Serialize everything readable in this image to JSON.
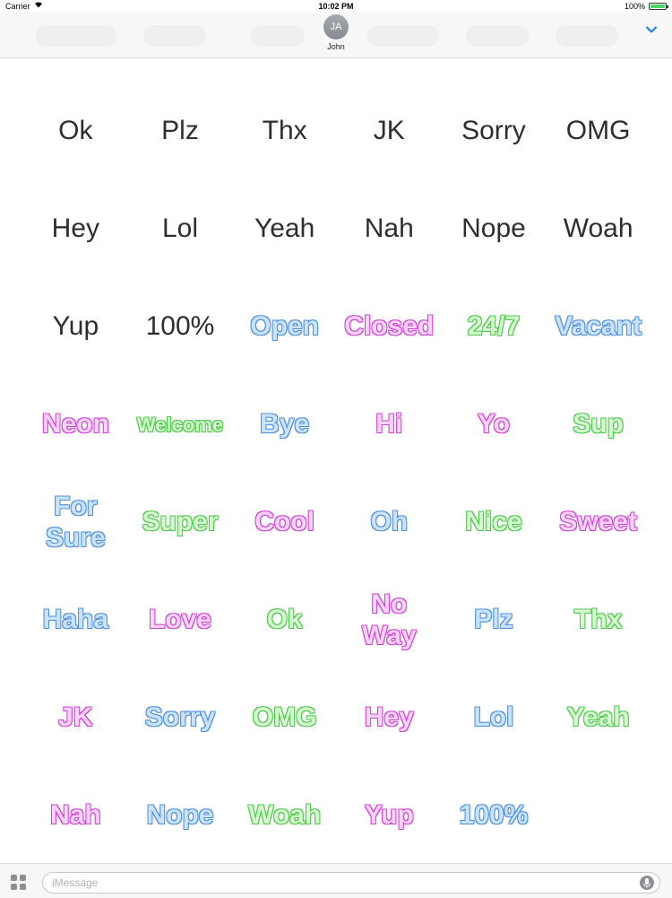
{
  "status_bar": {
    "carrier": "Carrier",
    "wifi_icon": "wifi-icon",
    "time": "10:02 PM",
    "battery_percent": "100%",
    "battery_level": 1.0
  },
  "header": {
    "avatar_initials": "JA",
    "contact_name": "John",
    "chevron_icon": "chevron-down-icon",
    "accent_color": "#1a7cff"
  },
  "stickers": [
    {
      "text": "Ok",
      "style": "dark"
    },
    {
      "text": "Plz",
      "style": "dark"
    },
    {
      "text": "Thx",
      "style": "dark"
    },
    {
      "text": "JK",
      "style": "dark"
    },
    {
      "text": "Sorry",
      "style": "dark"
    },
    {
      "text": "OMG",
      "style": "dark"
    },
    {
      "text": "Hey",
      "style": "dark"
    },
    {
      "text": "Lol",
      "style": "dark"
    },
    {
      "text": "Yeah",
      "style": "dark"
    },
    {
      "text": "Nah",
      "style": "dark"
    },
    {
      "text": "Nope",
      "style": "dark"
    },
    {
      "text": "Woah",
      "style": "dark"
    },
    {
      "text": "Yup",
      "style": "dark"
    },
    {
      "text": "100%",
      "style": "dark"
    },
    {
      "text": "Open",
      "style": "blue"
    },
    {
      "text": "Closed",
      "style": "pink"
    },
    {
      "text": "24/7",
      "style": "green"
    },
    {
      "text": "Vacant",
      "style": "blue"
    },
    {
      "text": "Neon",
      "style": "pink"
    },
    {
      "text": "Welcome",
      "style": "green",
      "size": "small"
    },
    {
      "text": "Bye",
      "style": "blue"
    },
    {
      "text": "Hi",
      "style": "pink"
    },
    {
      "text": "Yo",
      "style": "pink"
    },
    {
      "text": "Sup",
      "style": "green"
    },
    {
      "text": "For\nSure",
      "style": "blue"
    },
    {
      "text": "Super",
      "style": "green"
    },
    {
      "text": "Cool",
      "style": "pink"
    },
    {
      "text": "Oh",
      "style": "blue"
    },
    {
      "text": "Nice",
      "style": "green"
    },
    {
      "text": "Sweet",
      "style": "pink"
    },
    {
      "text": "Haha",
      "style": "blue"
    },
    {
      "text": "Love",
      "style": "pink"
    },
    {
      "text": "Ok",
      "style": "green"
    },
    {
      "text": "No\nWay",
      "style": "pink"
    },
    {
      "text": "Plz",
      "style": "blue"
    },
    {
      "text": "Thx",
      "style": "green"
    },
    {
      "text": "JK",
      "style": "pink"
    },
    {
      "text": "Sorry",
      "style": "blue"
    },
    {
      "text": "OMG",
      "style": "green"
    },
    {
      "text": "Hey",
      "style": "pink"
    },
    {
      "text": "Lol",
      "style": "blue"
    },
    {
      "text": "Yeah",
      "style": "green"
    },
    {
      "text": "Nah",
      "style": "pink"
    },
    {
      "text": "Nope",
      "style": "blue"
    },
    {
      "text": "Woah",
      "style": "green"
    },
    {
      "text": "Yup",
      "style": "pink"
    },
    {
      "text": "100%",
      "style": "blue"
    }
  ],
  "bottom_bar": {
    "apps_icon": "app-drawer-icon",
    "input_placeholder": "iMessage",
    "input_value": "",
    "mic_icon": "microphone-icon"
  }
}
